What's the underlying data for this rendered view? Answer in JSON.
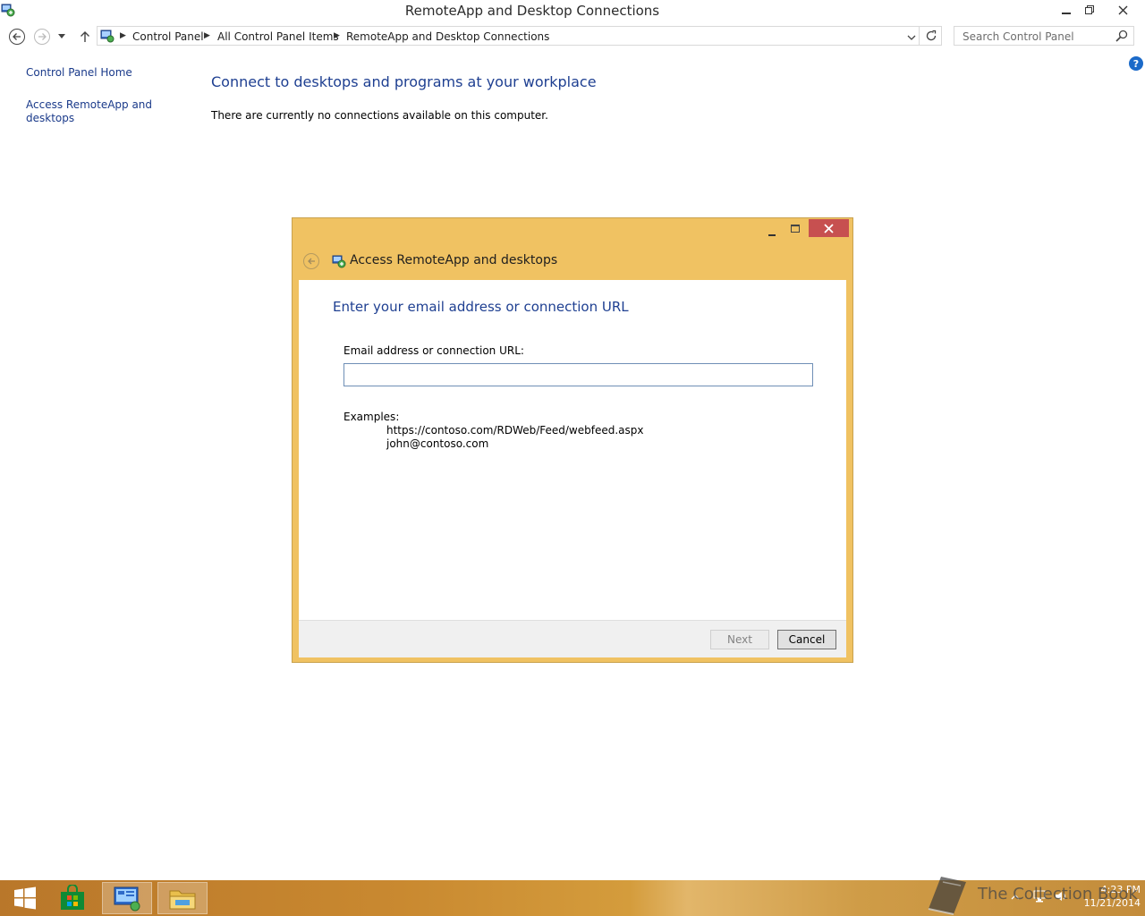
{
  "window": {
    "title": "RemoteApp and Desktop Connections"
  },
  "address_bar": {
    "crumbs": [
      "Control Panel",
      "All Control Panel Items",
      "RemoteApp and Desktop Connections"
    ]
  },
  "search": {
    "placeholder": "Search Control Panel"
  },
  "left_pane": {
    "items": [
      "Control Panel Home",
      "Access RemoteApp and desktops"
    ]
  },
  "main": {
    "heading": "Connect to desktops and programs at your workplace",
    "message": "There are currently no connections available on this computer."
  },
  "dialog": {
    "title": "Access RemoteApp and desktops",
    "heading": "Enter your email address or connection URL",
    "field_label": "Email address or connection URL:",
    "field_value": "",
    "examples_label": "Examples:",
    "examples": [
      "https://contoso.com/RDWeb/Feed/webfeed.aspx",
      "john@contoso.com"
    ],
    "next_label": "Next",
    "cancel_label": "Cancel"
  },
  "taskbar": {
    "time": "4:23 PM",
    "date": "11/21/2014"
  },
  "watermark": {
    "text": "The Collection Book"
  },
  "icons": {
    "help": "?",
    "close": "✕"
  },
  "colors": {
    "dialog_frame": "#f0c262",
    "close_button": "#c75050",
    "link": "#1a3a8a",
    "heading": "#1e3f91"
  }
}
